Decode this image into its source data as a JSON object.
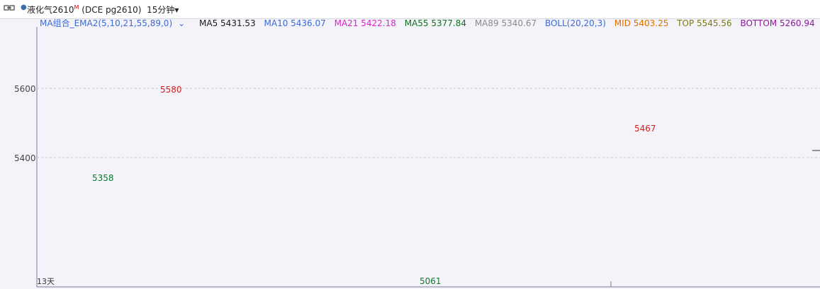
{
  "header": {
    "title": "液化气2610",
    "title_sup": "M",
    "exchange_code": "(DCE pg2610)",
    "period": "15分钟",
    "period_caret": "▾"
  },
  "legend": {
    "group": "MA组合_EMA2(5,10,21,55,89,0)",
    "group_caret": "⌄",
    "ma5": "MA5 5431.53",
    "ma10": "MA10 5436.07",
    "ma21": "MA21 5422.18",
    "ma55": "MA55 5377.84",
    "ma89": "MA89 5340.67",
    "boll": "BOLL(20,20,3)",
    "mid": "MID 5403.25",
    "top": "TOP 5545.56",
    "bottom": "BOTTOM 5260.94"
  },
  "colors": {
    "ma5": "#1a1a1a",
    "ma10": "#3a6ad8",
    "ma21": "#e020d0",
    "ma55": "#107020",
    "ma89": "#8a8a8a",
    "mid": "#e07000",
    "top": "#7a7a10",
    "bottom": "#8a1a9a",
    "up": "#d32020",
    "down": "#0a7a2a"
  },
  "chart_data": {
    "type": "candlestick",
    "y_ticks": [
      5400,
      5600
    ],
    "annotations": {
      "high_1": "5580",
      "low_1": "5358",
      "low_2": "5061",
      "high_2": "5467"
    }
  },
  "footer": {
    "label": "13天"
  }
}
